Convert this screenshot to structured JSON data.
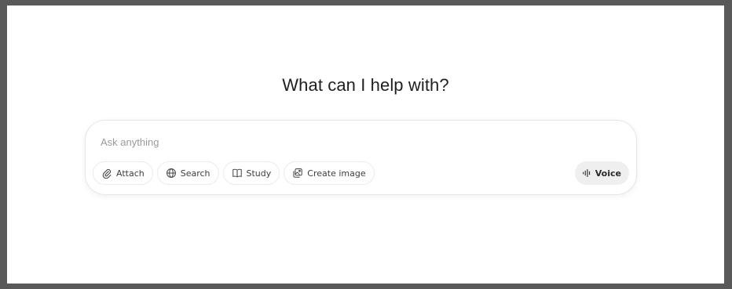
{
  "main": {
    "heading": "What can I help with?"
  },
  "composer": {
    "placeholder": "Ask anything",
    "tools": [
      {
        "label": "Attach",
        "icon": "paperclip-icon"
      },
      {
        "label": "Search",
        "icon": "globe-icon"
      },
      {
        "label": "Study",
        "icon": "book-icon"
      },
      {
        "label": "Create image",
        "icon": "image-icon"
      }
    ],
    "voice": {
      "label": "Voice",
      "icon": "voice-waveform-icon"
    }
  },
  "colors": {
    "frame": "#595959",
    "background": "#ffffff",
    "voice_button_bg": "#efefef",
    "text": "#1f1f1f",
    "placeholder": "#9a9a9a"
  }
}
